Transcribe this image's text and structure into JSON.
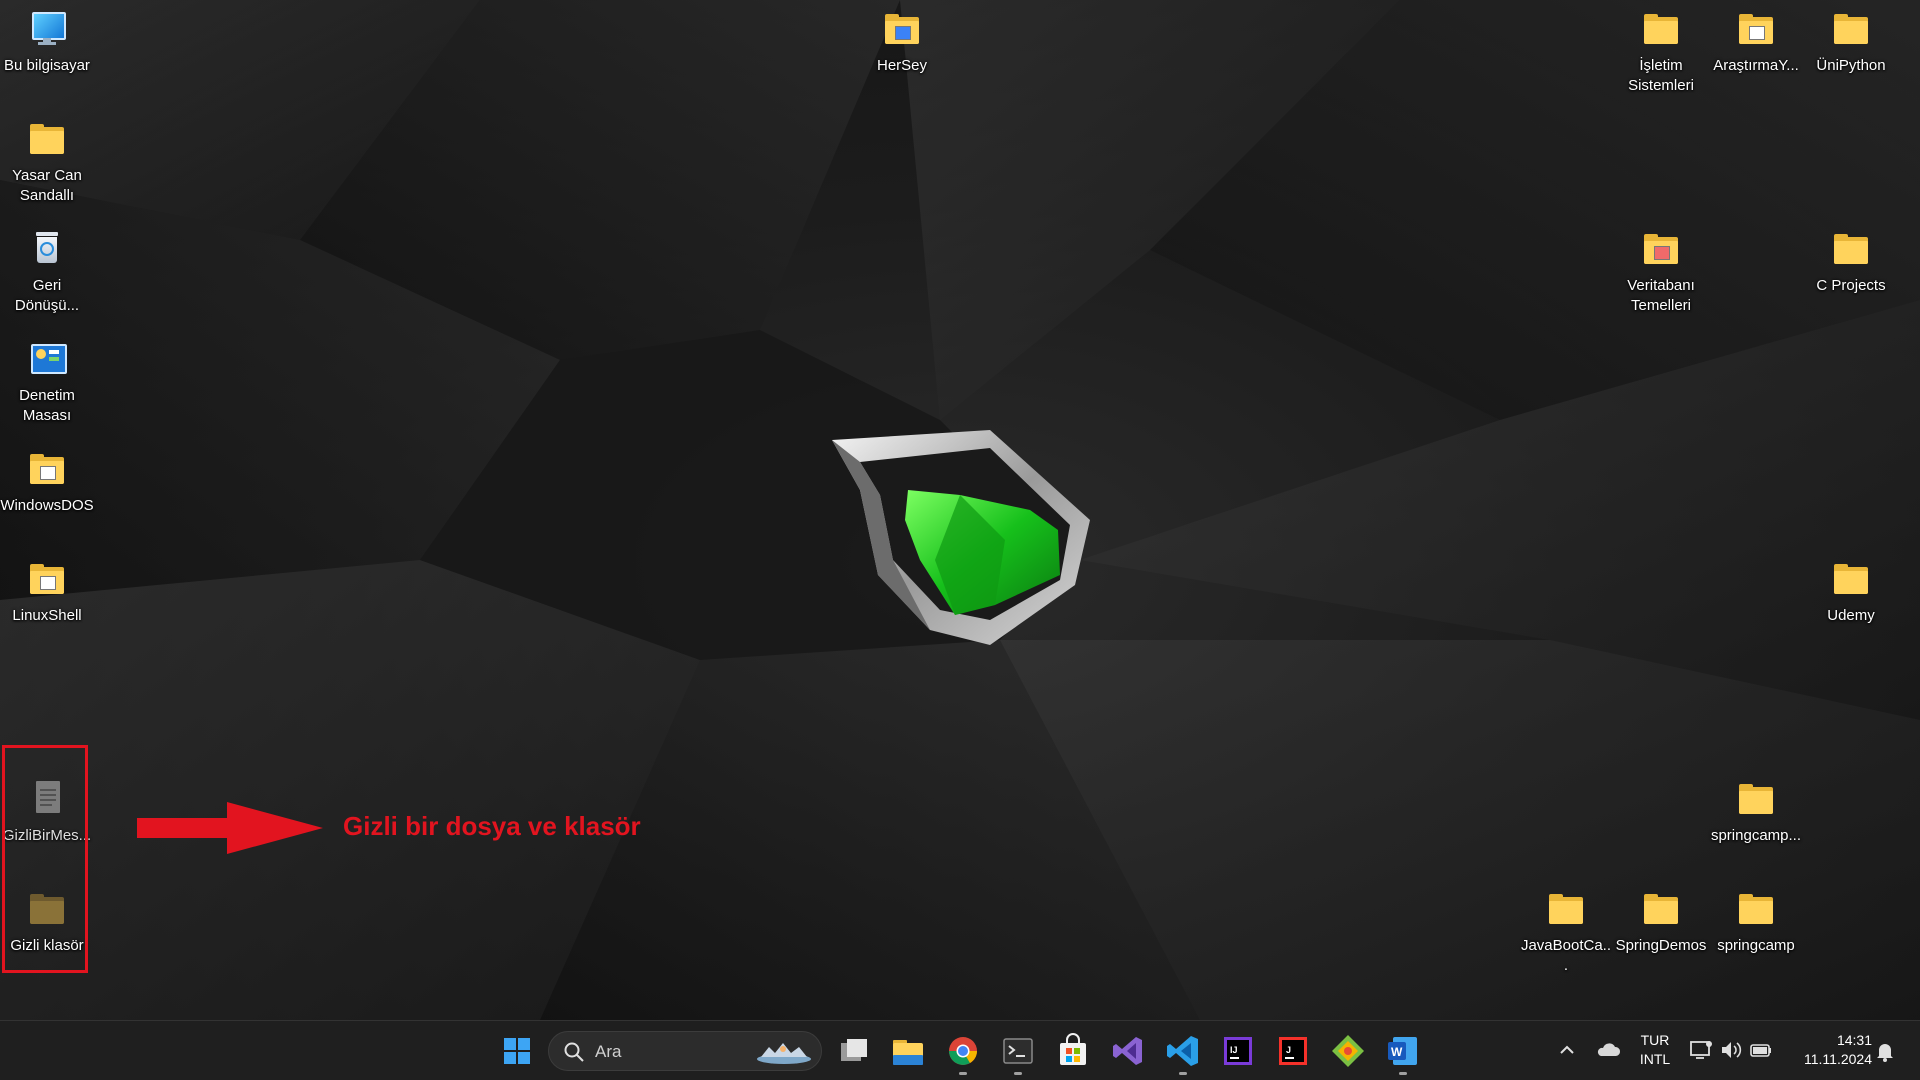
{
  "desktop": {
    "left_icons": [
      {
        "label": "Bu bilgisayar",
        "icon": "monitor-icon"
      },
      {
        "label": "Yasar Can\nSandallı",
        "icon": "user-folder-icon"
      },
      {
        "label": "Geri\nDönüşü...",
        "icon": "recycle-bin-icon"
      },
      {
        "label": "Denetim\nMasası",
        "icon": "control-panel-icon"
      },
      {
        "label": "WindowsDOS",
        "icon": "folder-icon"
      },
      {
        "label": "LinuxShell",
        "icon": "folder-icon"
      }
    ],
    "hidden_items": [
      {
        "label": "GizliBirMes...",
        "icon": "text-file-icon"
      },
      {
        "label": "Gizli klasör",
        "icon": "hidden-folder-icon"
      }
    ],
    "top_icons": [
      {
        "label": "HerSey",
        "icon": "folder-icon"
      }
    ],
    "right_icons": [
      {
        "label": "İşletim\nSistemleri",
        "icon": "folder-icon"
      },
      {
        "label": "AraştırmaY...",
        "icon": "folder-icon"
      },
      {
        "label": "ÜniPython",
        "icon": "folder-icon"
      },
      {
        "label": "Veritabanı\nTemelleri",
        "icon": "folder-icon"
      },
      {
        "label": "C Projects",
        "icon": "folder-icon"
      },
      {
        "label": "Udemy",
        "icon": "folder-icon"
      },
      {
        "label": "springcamp...",
        "icon": "folder-icon"
      },
      {
        "label": "JavaBootCa...",
        "icon": "folder-icon"
      },
      {
        "label": "SpringDemos",
        "icon": "folder-icon"
      },
      {
        "label": "springcamp",
        "icon": "folder-icon"
      }
    ]
  },
  "annotation": {
    "text": "Gizli bir dosya ve klasör",
    "color": "#e2141f"
  },
  "taskbar": {
    "search_placeholder": "Ara",
    "apps": [
      {
        "name": "start-button",
        "icon": "windows-logo-icon"
      },
      {
        "name": "task-view",
        "icon": "task-view-icon"
      },
      {
        "name": "file-explorer",
        "icon": "file-explorer-icon"
      },
      {
        "name": "chrome",
        "icon": "chrome-icon"
      },
      {
        "name": "terminal",
        "icon": "terminal-icon"
      },
      {
        "name": "microsoft-store",
        "icon": "store-icon"
      },
      {
        "name": "visual-studio",
        "icon": "visual-studio-icon"
      },
      {
        "name": "vscode",
        "icon": "vscode-icon"
      },
      {
        "name": "intellij",
        "icon": "intellij-icon"
      },
      {
        "name": "jetbrains-toolbox",
        "icon": "jetbrains-icon"
      },
      {
        "name": "git",
        "icon": "git-icon"
      },
      {
        "name": "word",
        "icon": "word-icon"
      }
    ],
    "tray": {
      "language_line1": "TUR",
      "language_line2": "INTL",
      "time": "14:31",
      "date": "11.11.2024"
    }
  },
  "colors": {
    "folder": "#ffd35c",
    "annotation_red": "#e2141f",
    "taskbar_bg": "#1f1f1f",
    "logo_green": "#2fd12a"
  }
}
